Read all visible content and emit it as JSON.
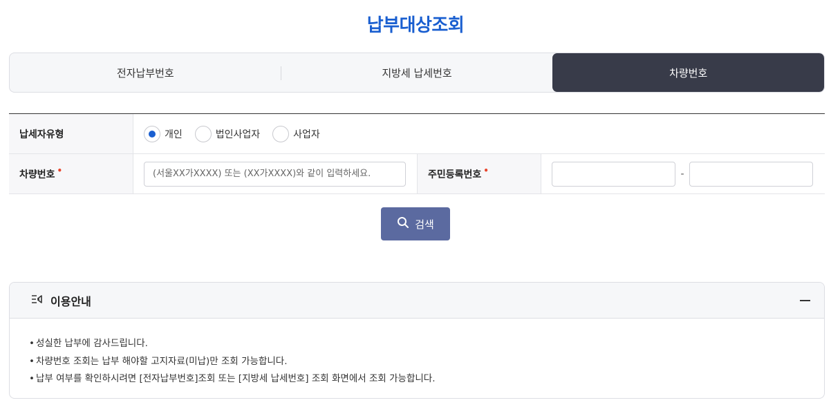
{
  "page": {
    "title": "납부대상조회"
  },
  "tabs": [
    {
      "label": "전자납부번호",
      "active": false
    },
    {
      "label": "지방세 납세번호",
      "active": false
    },
    {
      "label": "차량번호",
      "active": true
    }
  ],
  "form": {
    "taxpayer_type": {
      "label": "납세자유형",
      "options": [
        {
          "label": "개인",
          "checked": true
        },
        {
          "label": "법인사업자",
          "checked": false
        },
        {
          "label": "사업자",
          "checked": false
        }
      ]
    },
    "car_number": {
      "label": "차량번호",
      "required_mark": "•",
      "placeholder": "(서울XX가XXXX) 또는 (XX가XXXX)와 같이 입력하세요.",
      "value": ""
    },
    "resident_number": {
      "label": "주민등록번호",
      "required_mark": "•",
      "first_value": "",
      "second_value": "",
      "separator": "-"
    }
  },
  "search_button": {
    "label": "검색",
    "icon": "search-icon"
  },
  "guide": {
    "title": "이용안내",
    "icon": "notice-list-icon",
    "collapse_icon": "minus-icon",
    "items": [
      "성실한 납부에 감사드립니다.",
      "차량번호 조회는 납부 해야할 고지자료(미납)만 조회 가능합니다.",
      "납부 여부를 확인하시려면 [전자납부번호]조회 또는 [지방세 납세번호] 조회 화면에서 조회 가능합니다."
    ]
  },
  "colors": {
    "accent": "#1a5fd0",
    "active_tab": "#383b49",
    "button": "#5b6aa0",
    "required": "#e8452c"
  }
}
